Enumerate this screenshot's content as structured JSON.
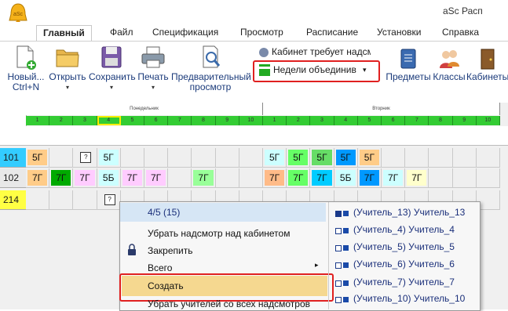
{
  "app": {
    "title": "aSc Расп"
  },
  "tabs": [
    "Главный",
    "Файл",
    "Спецификация",
    "Просмотр",
    "Расписание",
    "Установки",
    "Справка"
  ],
  "ribbon": {
    "buttons": [
      {
        "label": "Новый...",
        "sub": "Ctrl+N"
      },
      {
        "label": "Открыть",
        "sub": "▾"
      },
      {
        "label": "Сохранить",
        "sub": "▾"
      },
      {
        "label": "Печать",
        "sub": "▾"
      },
      {
        "label": "Предварительный",
        "sub": "просмотр"
      }
    ],
    "combo1": "Кабинет требует надсмотр",
    "combo2": "Недели объединив",
    "right_buttons": [
      "Предметы",
      "Классы",
      "Кабинеты"
    ]
  },
  "grid": {
    "days": [
      "Понедельник",
      "Вторник"
    ],
    "periods": [
      "1",
      "2",
      "3",
      "4",
      "5",
      "6",
      "7",
      "8",
      "9",
      "10"
    ],
    "rows": [
      {
        "room": "101",
        "room_color": "#33ccff",
        "lessons": [
          {
            "p": 0,
            "text": "5Г",
            "bg": "#ffcc88"
          },
          {
            "p": 2,
            "text": "?",
            "q": true
          },
          {
            "p": 3,
            "text": "5Г",
            "bg": "#ccffff"
          },
          {
            "p": 10,
            "text": "5Г",
            "bg": "#ccffff"
          },
          {
            "p": 11,
            "text": "5Г",
            "bg": "#66ff66"
          },
          {
            "p": 12,
            "text": "5Г",
            "bg": "#66dd66"
          },
          {
            "p": 13,
            "text": "5Г",
            "bg": "#0099ff"
          },
          {
            "p": 14,
            "text": "5Г",
            "bg": "#ffcc88"
          }
        ]
      },
      {
        "room": "102",
        "room_color": "#e8e8e8",
        "lessons": [
          {
            "p": 0,
            "text": "7Г",
            "bg": "#ffcc88"
          },
          {
            "p": 1,
            "text": "7Г",
            "bg": "#00aa00"
          },
          {
            "p": 2,
            "text": "7Г",
            "bg": "#ffccff"
          },
          {
            "p": 3,
            "text": "5Б",
            "bg": "#ccffff"
          },
          {
            "p": 4,
            "text": "7Г",
            "bg": "#ffccff"
          },
          {
            "p": 5,
            "text": "7Г",
            "bg": "#ffccff"
          },
          {
            "p": 7,
            "text": "7Г",
            "bg": "#99ff99"
          },
          {
            "p": 10,
            "text": "7Г",
            "bg": "#ffbb88"
          },
          {
            "p": 11,
            "text": "7Г",
            "bg": "#66ff66"
          },
          {
            "p": 12,
            "text": "7Г",
            "bg": "#00ccff"
          },
          {
            "p": 13,
            "text": "5Б",
            "bg": "#ccffff"
          },
          {
            "p": 14,
            "text": "7Г",
            "bg": "#0099ff"
          },
          {
            "p": 15,
            "text": "7Г",
            "bg": "#ccffff"
          },
          {
            "p": 16,
            "text": "7Г",
            "bg": "#ffffcc"
          }
        ]
      },
      {
        "room": "214",
        "room_color": "#ffff44",
        "lessons": [
          {
            "p": 3,
            "text": "?",
            "q": true
          }
        ]
      }
    ]
  },
  "context_menu": {
    "header": "4/5 (15)",
    "items": [
      "Убрать надсмотр над кабинетом",
      "Закрепить",
      "Всего",
      "Создать",
      "Убрать учителей со всех надсмотров"
    ],
    "teachers": [
      "(Учитель_13) Учитель_13",
      "(Учитель_4) Учитель_4",
      "(Учитель_5) Учитель_5",
      "(Учитель_6) Учитель_6",
      "(Учитель_7) Учитель_7",
      "(Учитель_10) Учитель_10"
    ]
  }
}
